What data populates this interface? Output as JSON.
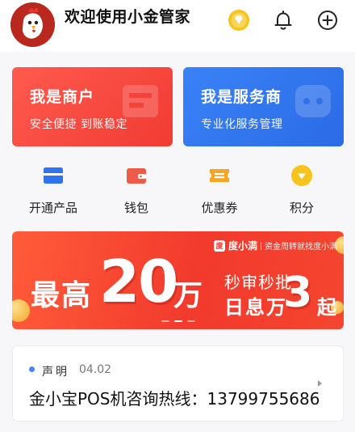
{
  "header": {
    "welcome": "欢迎使用小金管家",
    "icons": [
      "vip-badge-icon",
      "bell-icon",
      "plus-icon"
    ]
  },
  "cards": [
    {
      "title": "我是商户",
      "subtitle": "安全便捷 到账稳定",
      "color": "#f44336"
    },
    {
      "title": "我是服务商",
      "subtitle": "专业化服务管理",
      "color": "#2f73ee"
    }
  ],
  "quick_actions": [
    {
      "label": "开通产品",
      "icon": "product-card-icon",
      "color": "#2f73ee"
    },
    {
      "label": "钱包",
      "icon": "wallet-icon",
      "color": "#f05a4a"
    },
    {
      "label": "优惠券",
      "icon": "coupon-icon",
      "color": "#f5a623"
    },
    {
      "label": "积分",
      "icon": "points-icon",
      "color": "#f7c31c"
    }
  ],
  "banner": {
    "brand": "度小满",
    "slogan": "资金周转就找度小满",
    "max_prefix": "最高",
    "amount": "20",
    "amount_unit": "万",
    "feature": "秒审秒批",
    "daily_prefix": "日息万",
    "daily_value": "3",
    "daily_suffix": "起",
    "slide_count": 3,
    "active_slide": 1
  },
  "notice": {
    "label": "声明",
    "date": "04.02",
    "text": "金小宝POS机咨询热线：13799755686"
  }
}
